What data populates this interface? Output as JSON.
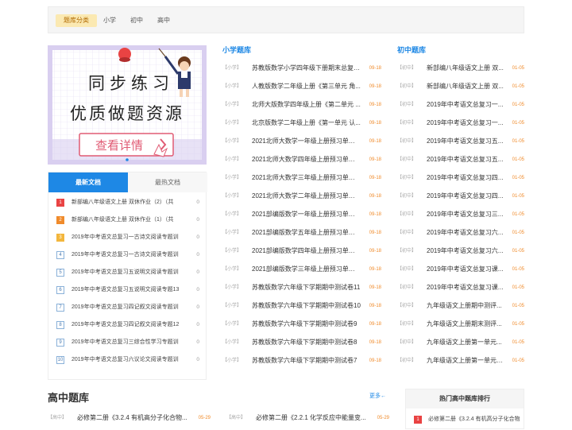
{
  "filter": {
    "tabs": [
      "题库分类",
      "小学",
      "初中",
      "高中"
    ]
  },
  "banner": {
    "line1": "同步练习",
    "line2": "优质做题资源",
    "button": "查看详情"
  },
  "doc_panel": {
    "tabs": [
      "最新文档",
      "最热文档"
    ],
    "items": [
      {
        "rank": "1",
        "title": "新部编八年级语文上册 双休作业（2）（共",
        "count": "0"
      },
      {
        "rank": "2",
        "title": "新部编八年级语文上册 双休作业（1）（共",
        "count": "0"
      },
      {
        "rank": "3",
        "title": "2019年中考语文总复习一古诗文阅读专题训",
        "count": "0"
      },
      {
        "rank": "4",
        "title": "2019年中考语文总复习一古诗文阅读专题训",
        "count": "0"
      },
      {
        "rank": "5",
        "title": "2019年中考语文总复习五说明文阅读专题训",
        "count": "0"
      },
      {
        "rank": "6",
        "title": "2019年中考语文总复习五说明文阅读专题13",
        "count": "0"
      },
      {
        "rank": "7",
        "title": "2019年中考语文总复习四记叙文阅读专题训",
        "count": "0"
      },
      {
        "rank": "8",
        "title": "2019年中考语文总复习四记叙文阅读专题12",
        "count": "0"
      },
      {
        "rank": "9",
        "title": "2019年中考语文总复习三综合性学习专题训",
        "count": "0"
      },
      {
        "rank": "10",
        "title": "2019年中考语文总复习六议论文阅读专题训",
        "count": "0"
      }
    ]
  },
  "primary": {
    "title": "小学题库",
    "items": [
      {
        "tag": "【小学】",
        "title": "苏教版数学小学四年级下册期末总复习...",
        "date": "09-18"
      },
      {
        "tag": "【小学】",
        "title": "人教版数学二年级上册《第三单元 角...",
        "date": "09-18"
      },
      {
        "tag": "【小学】",
        "title": "北师大版数学四年级上册《第二单元 ...",
        "date": "09-18"
      },
      {
        "tag": "【小学】",
        "title": "北京版数学二年级上册《第一单元 认...",
        "date": "09-18"
      },
      {
        "tag": "【小学】",
        "title": "2021北师大数学一年级上册预习单练习",
        "date": "09-18"
      },
      {
        "tag": "【小学】",
        "title": "2021北师大数学四年级上册预习单练习",
        "date": "09-18"
      },
      {
        "tag": "【小学】",
        "title": "2021北师大数学三年级上册预习单练习",
        "date": "09-18"
      },
      {
        "tag": "【小学】",
        "title": "2021北师大数学二年级上册预习单练习",
        "date": "09-18"
      },
      {
        "tag": "【小学】",
        "title": "2021部编版数学一年级上册预习单练习",
        "date": "09-18"
      },
      {
        "tag": "【小学】",
        "title": "2021部编版数学五年级上册预习单练习",
        "date": "09-18"
      },
      {
        "tag": "【小学】",
        "title": "2021部编版数学四年级上册预习单练习",
        "date": "09-18"
      },
      {
        "tag": "【小学】",
        "title": "2021部编版数学三年级上册预习单练习",
        "date": "09-18"
      },
      {
        "tag": "【小学】",
        "title": "苏教版数学六年级下学期期中测试卷11",
        "date": "09-18"
      },
      {
        "tag": "【小学】",
        "title": "苏教版数学六年级下学期期中测试卷10",
        "date": "09-18"
      },
      {
        "tag": "【小学】",
        "title": "苏教版数学六年级下学期期中测试卷9",
        "date": "09-18"
      },
      {
        "tag": "【小学】",
        "title": "苏教版数学六年级下学期期中测试卷8",
        "date": "09-18"
      },
      {
        "tag": "【小学】",
        "title": "苏教版数学六年级下学期期中测试卷7",
        "date": "09-18"
      }
    ]
  },
  "junior": {
    "title": "初中题库",
    "items": [
      {
        "tag": "【初中】",
        "title": "新部编八年级语文上册 双...",
        "date": "01-05"
      },
      {
        "tag": "【初中】",
        "title": "新部编八年级语文上册 双...",
        "date": "01-05"
      },
      {
        "tag": "【初中】",
        "title": "2019年中考语文总复习一...",
        "date": "01-05"
      },
      {
        "tag": "【初中】",
        "title": "2019年中考语文总复习一...",
        "date": "01-05"
      },
      {
        "tag": "【初中】",
        "title": "2019年中考语文总复习五...",
        "date": "01-05"
      },
      {
        "tag": "【初中】",
        "title": "2019年中考语文总复习五...",
        "date": "01-05"
      },
      {
        "tag": "【初中】",
        "title": "2019年中考语文总复习四...",
        "date": "01-05"
      },
      {
        "tag": "【初中】",
        "title": "2019年中考语文总复习四...",
        "date": "01-05"
      },
      {
        "tag": "【初中】",
        "title": "2019年中考语文总复习三...",
        "date": "01-05"
      },
      {
        "tag": "【初中】",
        "title": "2019年中考语文总复习六...",
        "date": "01-05"
      },
      {
        "tag": "【初中】",
        "title": "2019年中考语文总复习六...",
        "date": "01-05"
      },
      {
        "tag": "【初中】",
        "title": "2019年中考语文总复习课...",
        "date": "01-05"
      },
      {
        "tag": "【初中】",
        "title": "2019年中考语文总复习课...",
        "date": "01-05"
      },
      {
        "tag": "【初中】",
        "title": "九年级语文上册期中测评...",
        "date": "01-05"
      },
      {
        "tag": "【初中】",
        "title": "九年级语文上册期末测评...",
        "date": "01-05"
      },
      {
        "tag": "【初中】",
        "title": "九年级语文上册第一单元...",
        "date": "01-05"
      },
      {
        "tag": "【初中】",
        "title": "九年级语文上册第一单元5...",
        "date": "01-05"
      }
    ]
  },
  "senior": {
    "title": "高中题库",
    "more": "更多",
    "items": [
      {
        "tag": "【高中】",
        "title": "必修第二册《3.2.4 有机高分子化合物...",
        "date": "05-29"
      },
      {
        "tag": "【高中】",
        "title": "必修第二册《2.2.1 化学反应中能量变...",
        "date": "05-29"
      }
    ]
  },
  "hot": {
    "title": "热门高中题库排行",
    "items": [
      {
        "rank": "1",
        "title": "必修第二册《3.2.4 有机高分子化合物"
      }
    ]
  },
  "colors": {
    "accent": "#1e88e5",
    "date": "#f08b2b",
    "rank1": "#e94343",
    "rank2": "#f08b2b",
    "rank3": "#f3b63c"
  }
}
